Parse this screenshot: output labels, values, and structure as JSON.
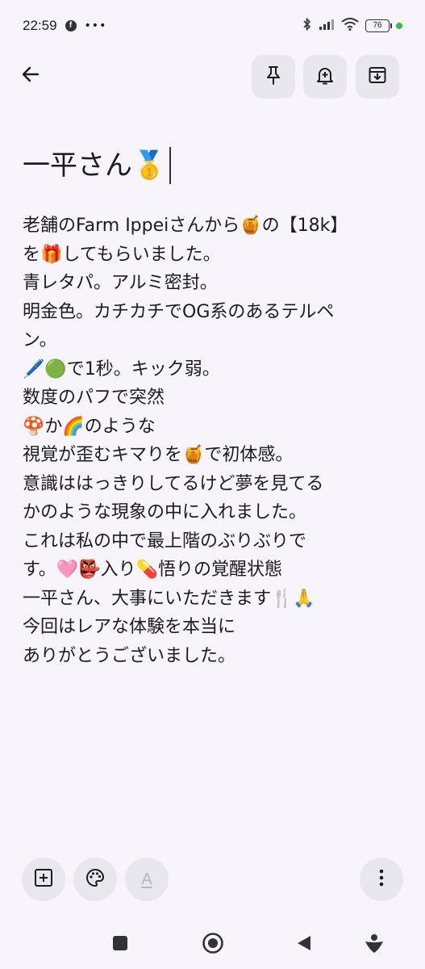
{
  "status_bar": {
    "time": "22:59",
    "fb_letter": "f",
    "more_dots": "•••",
    "battery": "76",
    "icons": [
      "facebook-icon",
      "more-dots-icon",
      "bluetooth-icon",
      "signal-icon",
      "wifi-icon",
      "battery-icon"
    ]
  },
  "toolbar": {
    "icons": [
      "back-arrow-icon",
      "pin-icon",
      "add-reminder-icon",
      "archive-icon"
    ]
  },
  "note": {
    "title": "一平さん🥇",
    "lines": [
      "老舗のFarm Ippeiさんから🍯の【18k】",
      "を🎁してもらいました。",
      "青レタパ。アルミ密封。",
      "明金色。カチカチでOG系のあるテルペ",
      "ン。",
      "🖊️🟢で1秒。キック弱。",
      "数度のパフで突然",
      "🍄か🌈のような",
      "視覚が歪むキマりを🍯で初体感。",
      "意識ははっきりしてるけど夢を見てる",
      "かのような現象の中に入れました。",
      "これは私の中で最上階のぶりぶりで",
      "す。🩷👺入り💊悟りの覚醒状態",
      "一平さん、大事にいただきます🍴🙏",
      "今回はレアな体験を本当に",
      "ありがとうございました。"
    ]
  },
  "bottom_bar": {
    "text_format_label": "A",
    "icons": [
      "add-box-icon",
      "palette-icon",
      "text-format-icon",
      "more-vert-icon"
    ]
  },
  "nav_bar": {
    "icons": [
      "recents-square-icon",
      "home-circle-icon",
      "back-triangle-icon",
      "assistant-icon"
    ]
  },
  "colors": {
    "background": "#f7f5fb",
    "button_bg": "#e9e7ee",
    "text": "#1c1b1f",
    "status_green": "#2fbf4a"
  }
}
